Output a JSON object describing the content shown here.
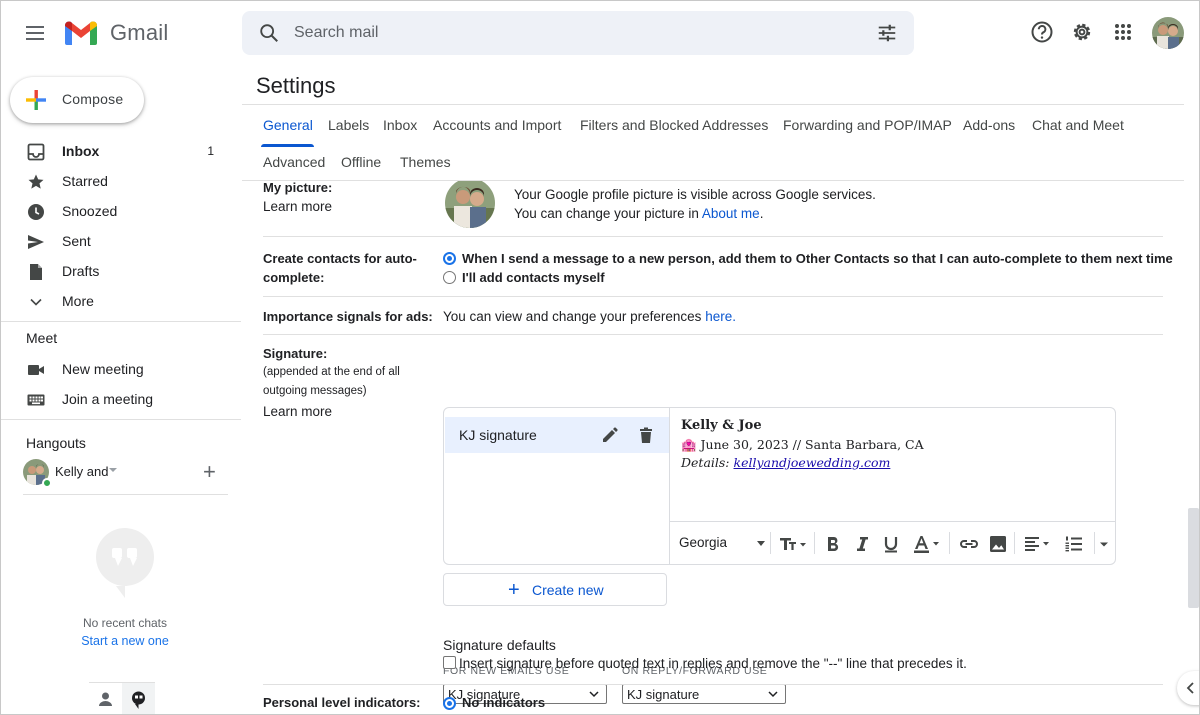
{
  "app": {
    "brand": "Gmail",
    "search_placeholder": "Search mail"
  },
  "sidebar": {
    "compose_label": "Compose",
    "items": [
      {
        "label": "Inbox",
        "count": "1",
        "icon": "inbox-icon"
      },
      {
        "label": "Starred",
        "icon": "star-icon"
      },
      {
        "label": "Snoozed",
        "icon": "clock-icon"
      },
      {
        "label": "Sent",
        "icon": "send-icon"
      },
      {
        "label": "Drafts",
        "icon": "draft-icon"
      },
      {
        "label": "More",
        "icon": "chevron-down-icon"
      }
    ],
    "meet_title": "Meet",
    "meet_items": [
      {
        "label": "New meeting",
        "icon": "video-icon"
      },
      {
        "label": "Join a meeting",
        "icon": "keyboard-icon"
      }
    ],
    "hangouts_title": "Hangouts",
    "hangouts_contact": "Kelly and",
    "no_chats": "No recent chats",
    "start_new": "Start a new one"
  },
  "settings": {
    "title": "Settings",
    "tabs": [
      "General",
      "Labels",
      "Inbox",
      "Accounts and Import",
      "Filters and Blocked Addresses",
      "Forwarding and POP/IMAP",
      "Add-ons",
      "Chat and Meet",
      "Advanced",
      "Offline",
      "Themes"
    ],
    "active_tab": "General",
    "my_picture": {
      "label": "My picture:",
      "learn_more": "Learn more",
      "line1": "Your Google profile picture is visible across Google services.",
      "line2_prefix": "You can change your picture in ",
      "line2_link": "About me",
      "line2_suffix": "."
    },
    "create_contacts": {
      "label_line1": "Create contacts for auto-",
      "label_line2": "complete:",
      "option1": "When I send a message to a new person, add them to Other Contacts so that I can auto-complete to them next time",
      "option2": "I'll add contacts myself",
      "selected": 0
    },
    "importance": {
      "label": "Importance signals for ads:",
      "text": "You can view and change your preferences ",
      "link": "here",
      "suffix": "."
    },
    "signature": {
      "label": "Signature:",
      "sub_line1": "(appended at the end of all",
      "sub_line2": "outgoing messages)",
      "learn_more": "Learn more",
      "list": [
        {
          "name": "KJ signature"
        }
      ],
      "content": {
        "line1": "Kelly & Joe",
        "line2": "🏩 June 30, 2023 // Santa Barbara, CA",
        "line3_prefix": "Details: ",
        "line3_link": "kellyandjoewedding.com"
      },
      "toolbar": {
        "font": "Georgia"
      },
      "create_new": "Create new"
    },
    "signature_defaults": {
      "title": "Signature defaults",
      "new_caption": "FOR NEW EMAILS USE",
      "reply_caption": "ON REPLY/FORWARD USE",
      "new_value": "KJ signature",
      "reply_value": "KJ signature",
      "insert_before_label": "Insert signature before quoted text in replies and remove the \"--\" line that precedes it.",
      "insert_before_checked": false
    },
    "personal_level": {
      "label": "Personal level indicators:",
      "option1": "No indicators"
    }
  },
  "colors": {
    "accent": "#0b57d0",
    "link": "#1a73e8",
    "selected_bg": "#e8f0fe"
  }
}
